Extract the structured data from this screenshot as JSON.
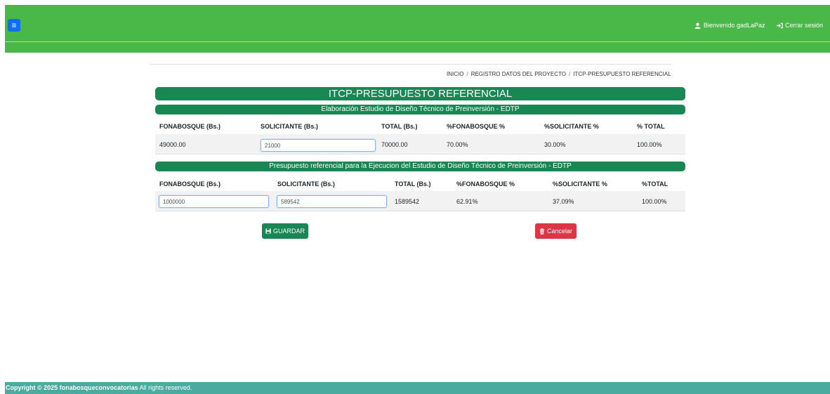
{
  "header": {
    "menu_icon": "hamburger-icon",
    "welcome_text": "Bienvenido gadLaPaz",
    "logout_text": "Cerrar sesión",
    "bar_color": "#4ab848"
  },
  "breadcrumb": {
    "items": [
      "INICIO",
      "REGISTRO DATOS DEL PROYECTO",
      "ITCP-PRESUPUESTO REFERENCIAL"
    ],
    "separator": "/"
  },
  "page_title": "ITCP-PRESUPUESTO REFERENCIAL",
  "section1": {
    "title": "Elaboración Estudio de Diseño Técnico de Preinversión - EDTP",
    "headers": [
      "FONABOSQUE (Bs.)",
      "SOLICITANTE (Bs.)",
      "TOTAL (Bs.)",
      "%FONABOSQUE %",
      "%SOLICITANTE %",
      "% TOTAL"
    ],
    "row": {
      "fonabosque": "49000.00",
      "solicitante_input": "21000",
      "total": "70000.00",
      "pct_fonabosque": "70.00%",
      "pct_solicitante": "30.00%",
      "pct_total": "100.00%"
    }
  },
  "section2": {
    "title": "Presupuesto referencial para la Ejecucion del Estudio de Diseño Técnico de Preinversión - EDTP",
    "headers": [
      "FONABOSQUE (Bs.)",
      "SOLICITANTE (Bs.)",
      "TOTAL (Bs.)",
      "%FONABOSQUE %",
      "%SOLICITANTE %",
      "%TOTAL"
    ],
    "row": {
      "fonabosque_input": "1000000",
      "solicitante_input": "589542",
      "total": "1589542",
      "pct_fonabosque": "62.91%",
      "pct_solicitante": "37.09%",
      "pct_total": "100.00%"
    }
  },
  "buttons": {
    "save_label": "GUARDAR",
    "save_icon": "floppy-disk-icon",
    "cancel_label": "Cancelar",
    "cancel_icon": "trash-icon"
  },
  "footer": {
    "copyright_bold": "Copyright © 2025 fonabosqueconvocatorias",
    "copyright_rest": " All rights reserved."
  },
  "colors": {
    "section_green": "#198754",
    "save_green": "#198754",
    "cancel_red": "#dc3545",
    "footer_teal": "#4aab9e"
  }
}
